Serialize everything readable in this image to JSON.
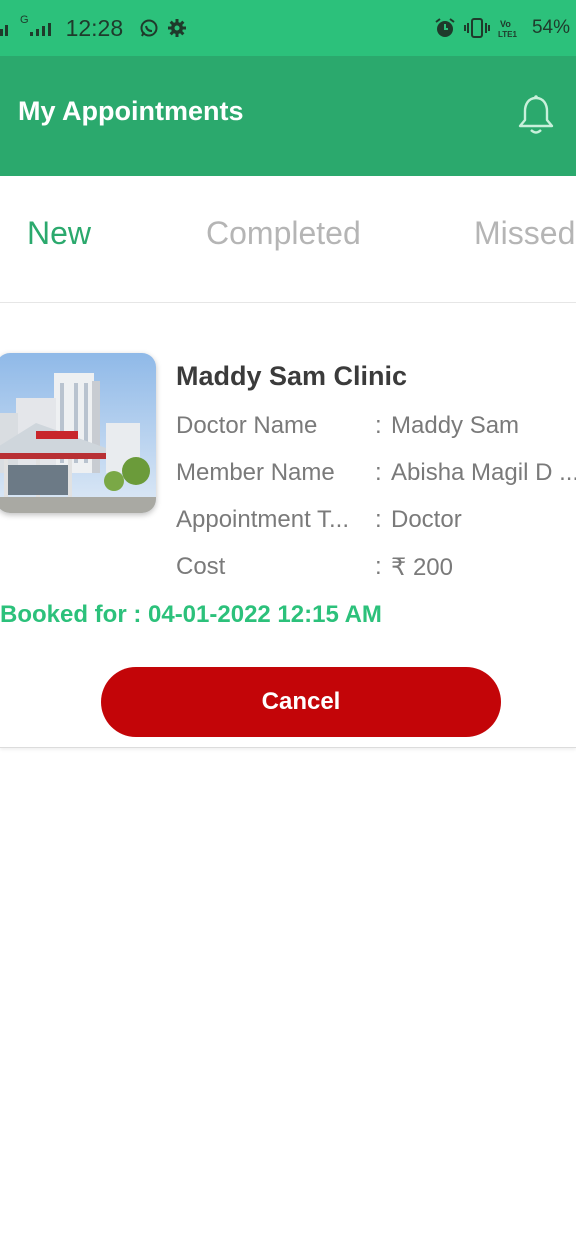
{
  "status_bar": {
    "network_label": "G",
    "time": "12:28",
    "volte_label": "VoLTE1",
    "battery_percent": "54%",
    "icons": [
      "signal-icon",
      "signal-icon",
      "whatsapp-icon",
      "gear-icon",
      "alarm-icon",
      "vibrate-icon",
      "volte-icon"
    ]
  },
  "app_bar": {
    "title": "My Appointments",
    "notification_icon": "bell-icon",
    "background": "#2ba96d"
  },
  "tabs": [
    {
      "label": "New",
      "selected": true
    },
    {
      "label": "Completed",
      "selected": false
    },
    {
      "label": "Missed",
      "selected": false
    }
  ],
  "appointment": {
    "clinic_name": "Maddy Sam Clinic",
    "rows": [
      {
        "label": "Doctor Name",
        "value": "Maddy Sam"
      },
      {
        "label": "Member Name",
        "value": "Abisha Magil D ..."
      },
      {
        "label": "Appointment T...",
        "value": "Doctor"
      },
      {
        "label": "Cost",
        "value": "₹ 200"
      }
    ],
    "booked_for": "Booked for : 04-01-2022 12:15 AM",
    "cancel_label": "Cancel"
  },
  "colors": {
    "status_bar": "#2cc17b",
    "accent": "#2ba96d",
    "booked_text": "#2cc17b",
    "cancel_button": "#c30508"
  }
}
